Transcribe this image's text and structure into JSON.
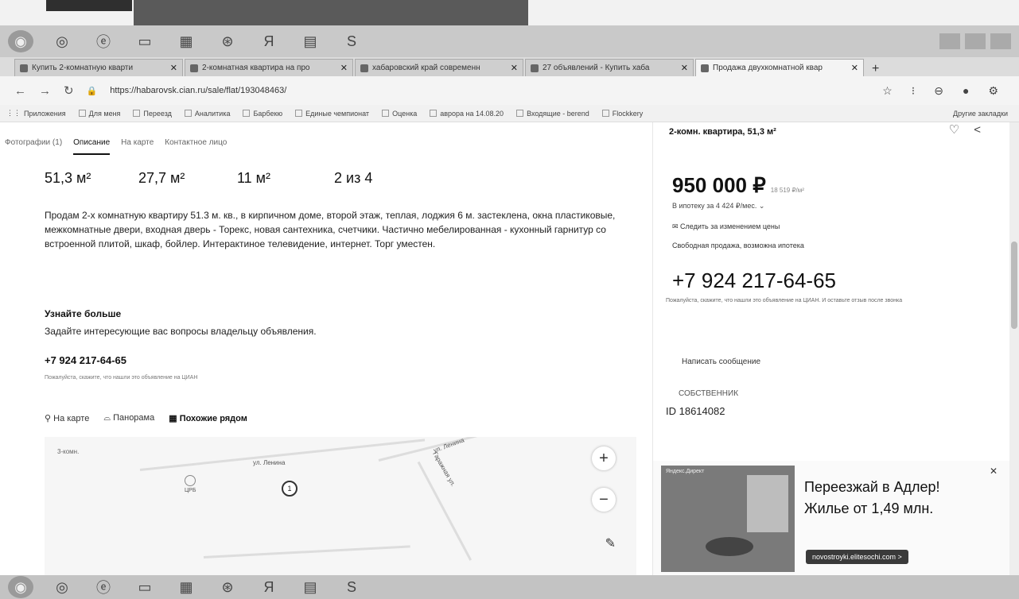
{
  "tabs": [
    {
      "label": "Купить 2-комнатную кварти",
      "active": false
    },
    {
      "label": "2-комнатная квартира на про",
      "active": false
    },
    {
      "label": "хабаровский край современн",
      "active": false
    },
    {
      "label": "27 объявлений - Купить хаба",
      "active": false
    },
    {
      "label": "Продажа двухкомнатной квар",
      "active": true
    }
  ],
  "address": {
    "url": "https://habarovsk.cian.ru/sale/flat/193048463/"
  },
  "bookmarks": [
    "Приложения",
    "Для меня",
    "Переезд",
    "Аналитика",
    "Барбекю",
    "Единые чемпионат",
    "Оценка",
    "аврора на 14.08.20",
    "Входящие - berend",
    "Flockkery"
  ],
  "bookmarks_more": "Другие закладки",
  "subnav": {
    "photos": "Фотографии (1)",
    "description": "Описание",
    "on_map": "На карте",
    "contact": "Контактное лицо"
  },
  "metrics": [
    "51,3 м²",
    "27,7 м²",
    "11 м²",
    "2 из 4"
  ],
  "description": "Продам 2-х комнатную квартиру 51.3 м. кв., в кирпичном доме, второй этаж, теплая, лоджия 6 м. застеклена, окна пластиковые, межкомнатные двери, входная дверь - Торекс, новая сантехника, счетчики. Частично мебелированная - кухонный гарнитур со встроенной плитой, шкаф, бойлер. Интерактиное телевидение, интернет. Торг уместен.",
  "learn_more": {
    "title": "Узнайте больше",
    "subtitle": "Задайте интересующие вас вопросы владельцу объявления.",
    "phone": "+7 924 217-64-65",
    "note": "Пожалуйста, скажите, что нашли это объявление на ЦИАН"
  },
  "map_links": {
    "on_map": "На карте",
    "panorama": "Панорама",
    "nearby": "Похожие рядом"
  },
  "map": {
    "street1": "ул. Ленина",
    "street2": "ул. Ленина",
    "street3": "Гаражная ул.",
    "poi": "ЦРБ",
    "marker": "1",
    "hint": "3-комн."
  },
  "right": {
    "title": "2-комн. квартира, 51,3 м²",
    "price": "950 000 ₽",
    "price_per_m": "18 519 ₽/м²",
    "mortgage": "В ипотеку за 4 424 ₽/мес. ⌄",
    "follow": "✉ Следить за изменением цены",
    "sale_type": "Свободная продажа, возможна ипотека",
    "phone": "+7 924 217-64-65",
    "note": "Пожалуйста, скажите, что нашли это объявление на ЦИАН. И оставьте отзыв после звонка",
    "message_button": "Написать сообщение",
    "owner": "СОБСТВЕННИК",
    "id": "ID 18614082"
  },
  "ad": {
    "label": "Яндекс.Директ",
    "title_line1": "Переезжай в Адлер!",
    "title_line2": "Жилье от 1,49 млн.",
    "link": "novostroyki.elitesochi.com >"
  }
}
